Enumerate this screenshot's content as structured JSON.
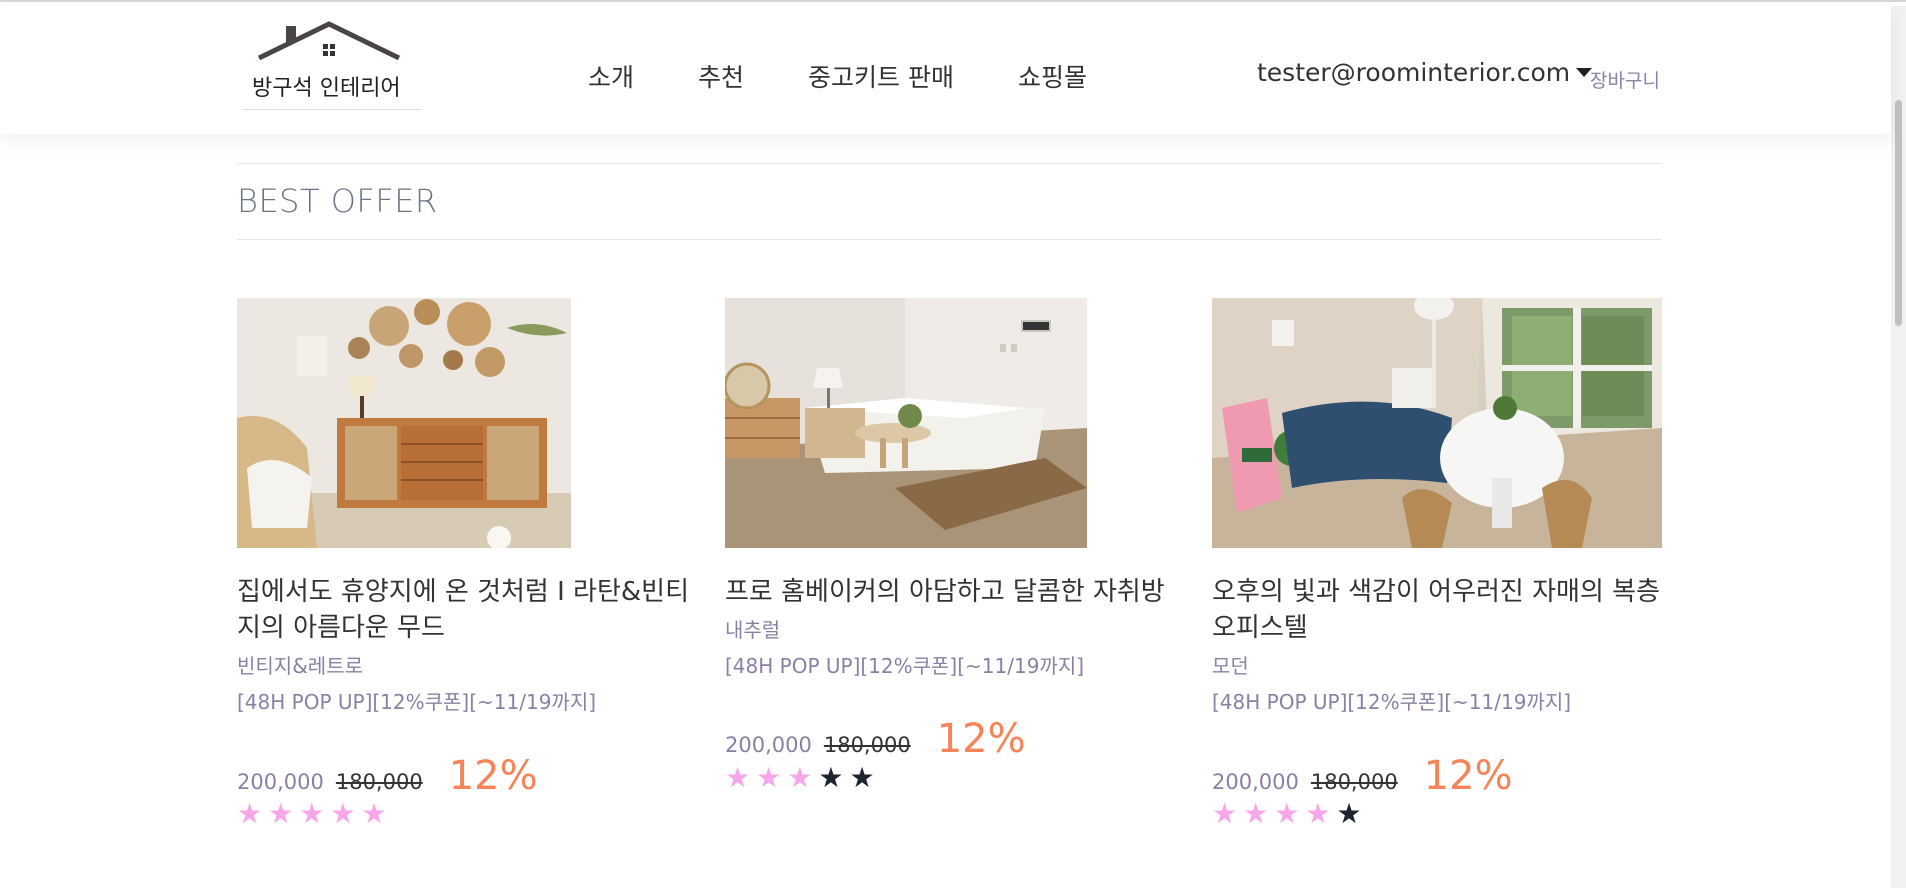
{
  "header": {
    "logo_text": "방구석 인테리어",
    "menu": [
      "소개",
      "추천",
      "중고키트 판매",
      "쇼핑몰"
    ],
    "user_email": "tester@roominterior.com",
    "cart_label": "장바구니"
  },
  "section": {
    "title": "BEST OFFER"
  },
  "products": [
    {
      "title": "집에서도 휴양지에 온 것처럼 I 라탄&빈티지의 아름다운 무드",
      "category": "빈티지&레트로",
      "promo": "[48H POP UP][12%쿠폰][~11/19까지]",
      "price": "200,000",
      "original_price": "180,000",
      "discount": "12%",
      "rating": 5,
      "image": "living-room-rattan-photo"
    },
    {
      "title": "프로 홈베이커의 아담하고 달콤한 자취방",
      "category": "내추럴",
      "promo": "[48H POP UP][12%쿠폰][~11/19까지]",
      "price": "200,000",
      "original_price": "180,000",
      "discount": "12%",
      "rating": 3,
      "image": "bedroom-photo"
    },
    {
      "title": "오후의 빛과 색감이 어우러진 자매의 복층 오피스텔",
      "category": "모던",
      "promo": "[48H POP UP][12%쿠폰][~11/19까지]",
      "price": "200,000",
      "original_price": "180,000",
      "discount": "12%",
      "rating": 4,
      "image": "sunlit-living-room-photo"
    }
  ],
  "colors": {
    "accent": "#f58459",
    "muted": "#8c7fa6",
    "star_on": "#f7a6e9",
    "star_off": "#1f2530"
  }
}
